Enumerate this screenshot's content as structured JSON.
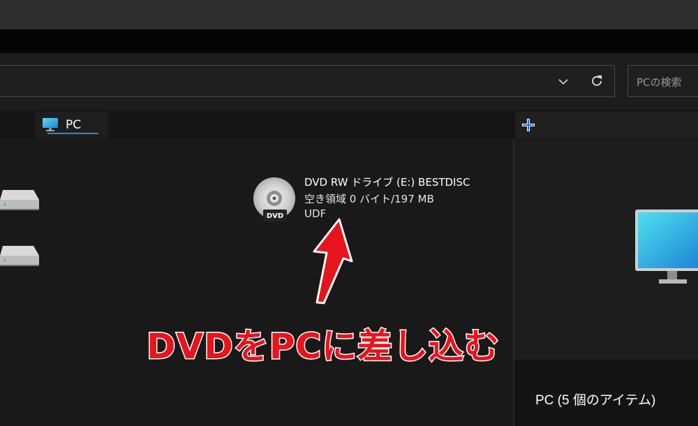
{
  "search": {
    "placeholder": "PCの検索"
  },
  "tab": {
    "label": "PC",
    "icon": "monitor-icon"
  },
  "newtab": {
    "icon": "plus-icon",
    "accent": "#1a8fe3"
  },
  "address": {
    "dropdown_icon": "chevron-down-icon",
    "refresh_icon": "refresh-icon"
  },
  "drives": [
    {
      "icon": "hard-drive-icon"
    },
    {
      "icon": "hard-drive-icon"
    }
  ],
  "dvd": {
    "badge": "DVD",
    "name": "DVD RW ドライブ (E:) BESTDISC",
    "space": "空き領域 0 バイト/197 MB",
    "filesystem": "UDF"
  },
  "details": {
    "title": "PC (5 個のアイテム)"
  },
  "annotation": {
    "text": "DVDをPCに差し込む",
    "color": "#e8141c"
  }
}
